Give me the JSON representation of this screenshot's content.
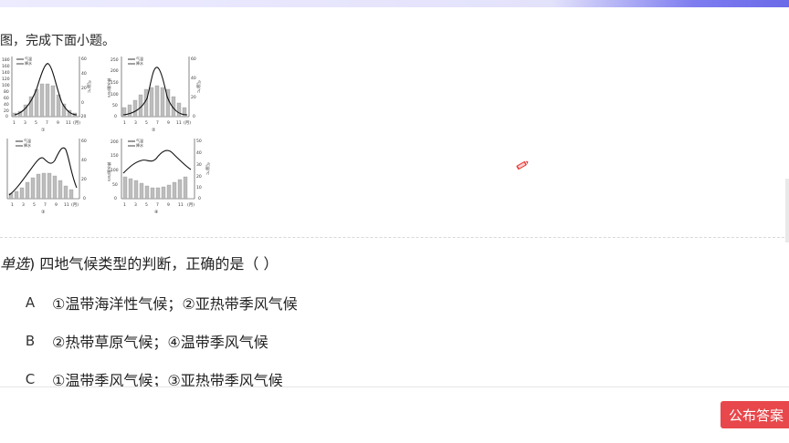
{
  "intro_text": "图，完成下面小题。",
  "charts": [
    {
      "id": "①",
      "legend": [
        "气温",
        "降水"
      ],
      "left_axis_ticks": [
        "180",
        "160",
        "140",
        "120",
        "100",
        "80",
        "60",
        "40",
        "20",
        "0"
      ],
      "right_axis_ticks": [
        "60",
        "40",
        "20",
        "0",
        "-20"
      ],
      "right_axis_label": "气温/℃",
      "x_ticks": [
        "1",
        "3",
        "5",
        "7",
        "9",
        "11"
      ],
      "x_unit": "(月)"
    },
    {
      "id": "②",
      "legend": [
        "气温",
        "降水"
      ],
      "left_axis_ticks": [
        "250",
        "200",
        "150",
        "100",
        "50",
        "0"
      ],
      "left_axis_label": "降水量/mm",
      "right_axis_ticks": [
        "60",
        "40",
        "20",
        "0"
      ],
      "right_axis_label": "气温/℃",
      "x_ticks": [
        "1",
        "3",
        "5",
        "7",
        "9",
        "11"
      ],
      "x_unit": "(月)"
    },
    {
      "id": "③",
      "legend": [
        "气温",
        "降水"
      ],
      "right_axis_ticks": [
        "60",
        "40",
        "20",
        "0"
      ],
      "x_ticks": [
        "1",
        "3",
        "5",
        "7",
        "9",
        "11"
      ],
      "x_unit": "(月)"
    },
    {
      "id": "④",
      "legend": [
        "气温",
        "降水"
      ],
      "left_axis_ticks": [
        "200",
        "150",
        "100",
        "50",
        "0"
      ],
      "left_axis_label": "降水量/mm",
      "right_axis_ticks": [
        "50",
        "40",
        "30",
        "20",
        "10",
        "0"
      ],
      "right_axis_label": "气温/℃",
      "x_ticks": [
        "1",
        "3",
        "5",
        "7",
        "9",
        "11"
      ],
      "x_unit": "(月)"
    }
  ],
  "question": {
    "type": "单选",
    "text": "四地气候类型的判断，正确的是（ ）"
  },
  "options": [
    {
      "letter": "A",
      "text": "①温带海洋性气候；②亚热带季风气候"
    },
    {
      "letter": "B",
      "text": "②热带草原气候；④温带季风气候"
    },
    {
      "letter": "C",
      "text": "①温带季风气候；③亚热带季风气候"
    }
  ],
  "publish_button": "公布答案",
  "colors": {
    "accent_red": "#e8474b",
    "bars": "#bdbdbd"
  }
}
